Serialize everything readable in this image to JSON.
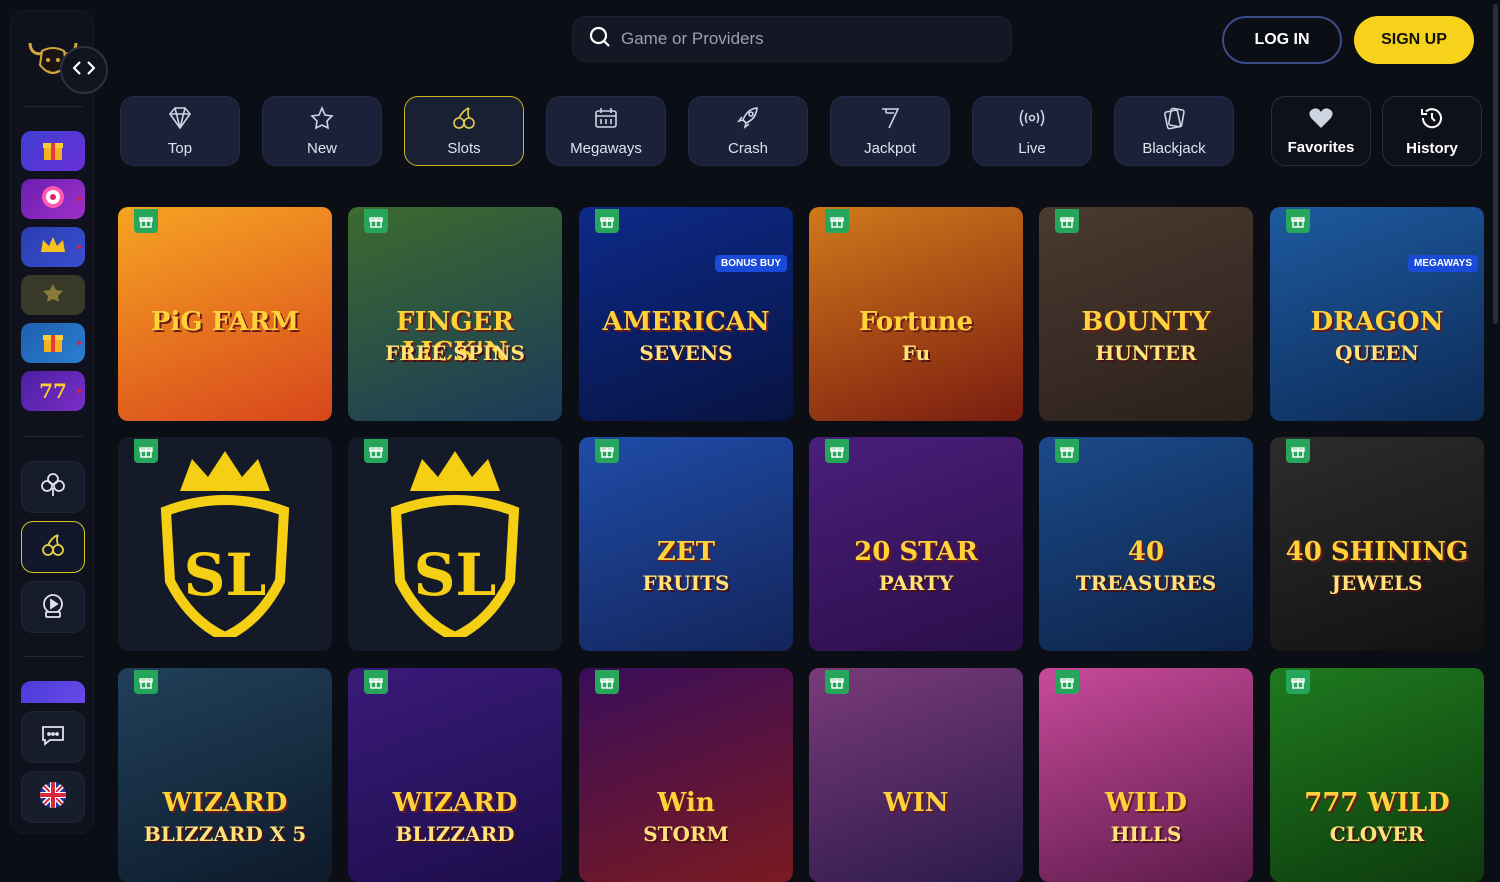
{
  "search": {
    "placeholder": "Game or Providers"
  },
  "header": {
    "login": "LOG IN",
    "signup": "SIGN UP"
  },
  "tabs": [
    {
      "label": "Top",
      "icon": "diamond-icon"
    },
    {
      "label": "New",
      "icon": "star-new-icon"
    },
    {
      "label": "Slots",
      "icon": "cherries-icon"
    },
    {
      "label": "Megaways",
      "icon": "calendar-slots-icon"
    },
    {
      "label": "Crash",
      "icon": "rocket-icon"
    },
    {
      "label": "Jackpot",
      "icon": "seven-icon"
    },
    {
      "label": "Live",
      "icon": "broadcast-icon"
    },
    {
      "label": "Blackjack",
      "icon": "cards-icon"
    }
  ],
  "side_tabs": {
    "favorites": "Favorites",
    "history": "History"
  },
  "games": {
    "row1": [
      {
        "title": "PiG FARM",
        "subtitle": "",
        "colors": [
          "#f7a423",
          "#d7461c"
        ]
      },
      {
        "title": "FINGER LICK'N",
        "subtitle": "FREE SPINS",
        "colors": [
          "#3d6b2e",
          "#1a3a5a"
        ]
      },
      {
        "title": "AMERICAN",
        "subtitle": "SEVENS",
        "badge": "BONUS BUY",
        "colors": [
          "#0d2a8a",
          "#071341"
        ]
      },
      {
        "title": "Fortune",
        "subtitle": "Fu",
        "colors": [
          "#d1791b",
          "#7a1c10"
        ]
      },
      {
        "title": "BOUNTY",
        "subtitle": "HUNTER",
        "colors": [
          "#4a3a30",
          "#2a201a"
        ]
      },
      {
        "title": "DRAGON",
        "subtitle": "QUEEN",
        "badge": "MEGAWAYS",
        "colors": [
          "#1d5aa0",
          "#0d2a55"
        ]
      }
    ],
    "row2": [
      {
        "title": "SL",
        "subtitle": "",
        "colors": [
          "#151a28",
          "#151a28"
        ]
      },
      {
        "title": "SL",
        "subtitle": "",
        "colors": [
          "#151a28",
          "#151a28"
        ]
      },
      {
        "title": "ZET",
        "subtitle": "FRUITS",
        "colors": [
          "#1f4ca8",
          "#13245a"
        ]
      },
      {
        "title": "20 STAR",
        "subtitle": "PARTY",
        "colors": [
          "#4a1e7a",
          "#2a0f4a"
        ]
      },
      {
        "title": "40",
        "subtitle": "TREASURES",
        "colors": [
          "#1b4a8a",
          "#0d2247"
        ]
      },
      {
        "title": "40 SHINING",
        "subtitle": "JEWELS",
        "colors": [
          "#2c2c2c",
          "#111111"
        ]
      }
    ],
    "row3": [
      {
        "title": "WIZARD",
        "subtitle": "BLIZZARD X 5",
        "colors": [
          "#20405a",
          "#0d1a2a"
        ]
      },
      {
        "title": "WIZARD",
        "subtitle": "BLIZZARD",
        "colors": [
          "#3a1a7a",
          "#1c0d4a"
        ]
      },
      {
        "title": "Win",
        "subtitle": "STORM",
        "colors": [
          "#3a0d5a",
          "#7a1a20"
        ]
      },
      {
        "title": "WIN",
        "subtitle": "",
        "colors": [
          "#7a3a7a",
          "#2a1a4a"
        ]
      },
      {
        "title": "WILD",
        "subtitle": "HILLS",
        "colors": [
          "#c84a9a",
          "#5a1a4a"
        ]
      },
      {
        "title": "777 WILD",
        "subtitle": "CLOVER",
        "colors": [
          "#1f7a1f",
          "#0d3a0d"
        ]
      }
    ]
  }
}
